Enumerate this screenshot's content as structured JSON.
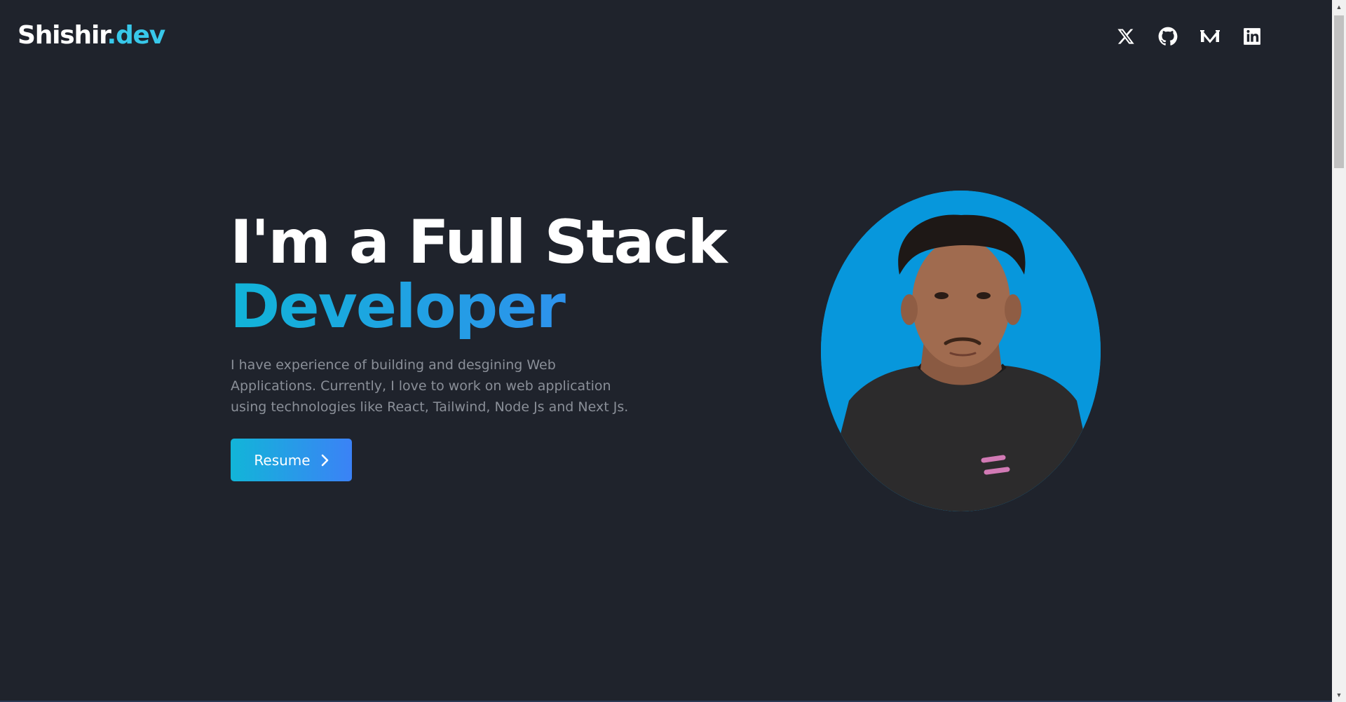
{
  "header": {
    "logo_main": "Shishir",
    "logo_accent": ".dev",
    "socials": [
      {
        "icon": "x-twitter-icon"
      },
      {
        "icon": "github-icon"
      },
      {
        "icon": "medium-icon"
      },
      {
        "icon": "linkedin-icon"
      }
    ]
  },
  "hero": {
    "title_line1": "I'm a Full Stack",
    "title_line2": "Developer",
    "description": "I have experience of building and desgining Web Applications. Currently, I love to work on web application using technologies like React, Tailwind, Node Js and Next Js.",
    "resume_label": "Resume"
  },
  "colors": {
    "background": "#1f232c",
    "accent": "#38c8ea",
    "gradient_start": "#11b4d8",
    "gradient_end": "#3b82f6",
    "avatar_bg": "#0797dc",
    "text_muted": "#8a8f98"
  }
}
